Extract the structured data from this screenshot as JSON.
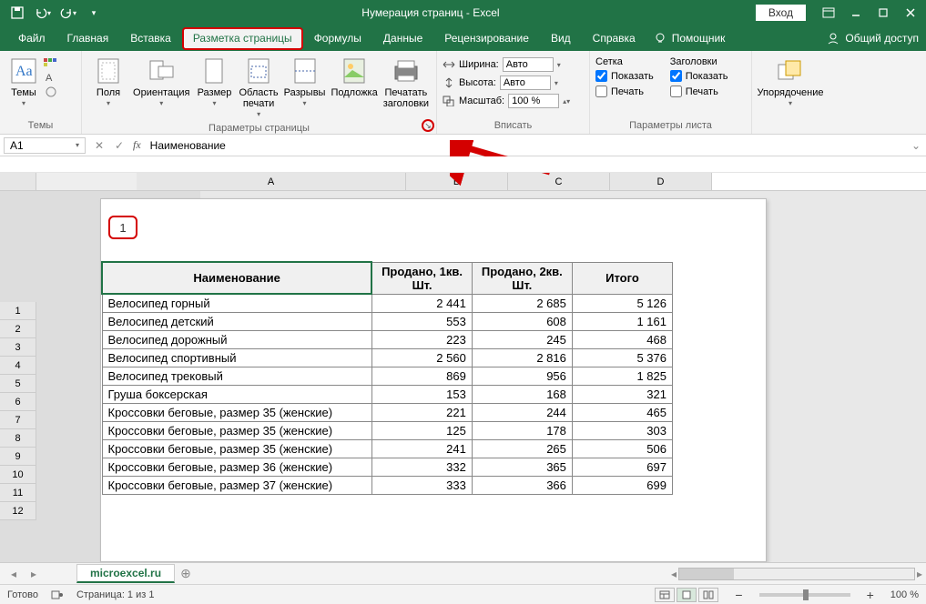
{
  "titlebar": {
    "title": "Нумерация страниц - Excel",
    "login": "Вход"
  },
  "menu": {
    "file": "Файл",
    "home": "Главная",
    "insert": "Вставка",
    "page_layout": "Разметка страницы",
    "formulas": "Формулы",
    "data": "Данные",
    "review": "Рецензирование",
    "view": "Вид",
    "help": "Справка",
    "assistant": "Помощник",
    "share": "Общий доступ"
  },
  "ribbon": {
    "themes": {
      "label": "Темы",
      "btn": "Темы"
    },
    "page_setup": {
      "label": "Параметры страницы",
      "margins": "Поля",
      "orientation": "Ориентация",
      "size": "Размер",
      "print_area": "Область печати",
      "breaks": "Разрывы",
      "background": "Подложка",
      "print_titles": "Печатать заголовки"
    },
    "scale": {
      "label": "Вписать",
      "width_lbl": "Ширина:",
      "width_val": "Авто",
      "height_lbl": "Высота:",
      "height_val": "Авто",
      "scale_lbl": "Масштаб:",
      "scale_val": "100 %"
    },
    "sheet_opts": {
      "label": "Параметры листа",
      "gridlines": "Сетка",
      "headings": "Заголовки",
      "show": "Показать",
      "print": "Печать"
    },
    "arrange": {
      "label": "",
      "btn": "Упорядочение"
    }
  },
  "formula_bar": {
    "cell": "A1",
    "value": "Наименование"
  },
  "columns": {
    "A": "A",
    "B": "B",
    "C": "C",
    "D": "D"
  },
  "page": {
    "number": "1"
  },
  "table": {
    "headers": {
      "name": "Наименование",
      "q1": "Продано, 1кв. Шт.",
      "q2": "Продано, 2кв. Шт.",
      "total": "Итого"
    },
    "rows": [
      {
        "n": "Велосипед горный",
        "q1": "2 441",
        "q2": "2 685",
        "t": "5 126"
      },
      {
        "n": "Велосипед детский",
        "q1": "553",
        "q2": "608",
        "t": "1 161"
      },
      {
        "n": "Велосипед дорожный",
        "q1": "223",
        "q2": "245",
        "t": "468"
      },
      {
        "n": "Велосипед спортивный",
        "q1": "2 560",
        "q2": "2 816",
        "t": "5 376"
      },
      {
        "n": "Велосипед трековый",
        "q1": "869",
        "q2": "956",
        "t": "1 825"
      },
      {
        "n": "Груша боксерская",
        "q1": "153",
        "q2": "168",
        "t": "321"
      },
      {
        "n": "Кроссовки беговые, размер 35 (женские)",
        "q1": "221",
        "q2": "244",
        "t": "465"
      },
      {
        "n": "Кроссовки беговые, размер 35 (женские)",
        "q1": "125",
        "q2": "178",
        "t": "303"
      },
      {
        "n": "Кроссовки беговые, размер 35 (женские)",
        "q1": "241",
        "q2": "265",
        "t": "506"
      },
      {
        "n": "Кроссовки беговые, размер 36 (женские)",
        "q1": "332",
        "q2": "365",
        "t": "697"
      },
      {
        "n": "Кроссовки беговые, размер 37 (женские)",
        "q1": "333",
        "q2": "366",
        "t": "699"
      }
    ]
  },
  "row_numbers": [
    "1",
    "2",
    "3",
    "4",
    "5",
    "6",
    "7",
    "8",
    "9",
    "10",
    "11",
    "12"
  ],
  "sheet_tab": "microexcel.ru",
  "status": {
    "ready": "Готово",
    "page": "Страница: 1 из 1",
    "zoom": "100 %"
  }
}
